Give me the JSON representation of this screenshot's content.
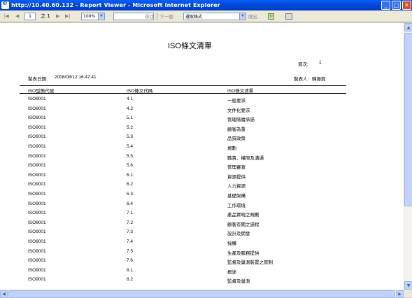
{
  "window": {
    "title": "http://10.40.60.132 - Report Viewer - Microsoft Internet Explorer",
    "minimize_glyph": "_",
    "maximize_glyph": "□",
    "close_glyph": "✕"
  },
  "toolbar": {
    "first_page": "|◀",
    "prev_page": "◀",
    "current_page": "1",
    "of_label": "之 1",
    "next_page": "▶",
    "last_page": "▶|",
    "zoom": "100%",
    "find_label": "尋找",
    "find_next_label": "下一個",
    "format_placeholder": "選取格式",
    "export_label": "匯出"
  },
  "report": {
    "title": "ISO條文清單",
    "page_label": "頁次:",
    "page_number": "1",
    "date_label": "製表日期:",
    "date_value": "2008/08/12 16:47:41",
    "creator_label": "製表人:",
    "creator_value": "陳振興",
    "columns": [
      "ISO型態代號",
      "ISO條文代碼",
      "ISO條文清單"
    ],
    "rows": [
      [
        "ISO9001",
        "4.1",
        "一般要求"
      ],
      [
        "ISO9001",
        "4.2",
        "文件化要求"
      ],
      [
        "ISO9001",
        "5.1",
        "管理階層承諾"
      ],
      [
        "ISO9001",
        "5.2",
        "顧客為重"
      ],
      [
        "ISO9001",
        "5.3",
        "品質政策"
      ],
      [
        "ISO9001",
        "5.4",
        "規劃"
      ],
      [
        "ISO9001",
        "5.5",
        "職責、權限及溝通"
      ],
      [
        "ISO9001",
        "5.6",
        "管理審查"
      ],
      [
        "ISO9001",
        "6.1",
        "資源提供"
      ],
      [
        "ISO9001",
        "6.2",
        "人力資源"
      ],
      [
        "ISO9001",
        "6.3",
        "基礎架構"
      ],
      [
        "ISO9001",
        "6.4",
        "工作環境"
      ],
      [
        "ISO9001",
        "7.1",
        "產品實現之規劃"
      ],
      [
        "ISO9001",
        "7.2",
        "顧客有關之過程"
      ],
      [
        "ISO9001",
        "7.3",
        "設計及開發"
      ],
      [
        "ISO9001",
        "7.4",
        "採購"
      ],
      [
        "ISO9001",
        "7.5",
        "生產及服務提供"
      ],
      [
        "ISO9001",
        "7.6",
        "監督及量測裝置之管制"
      ],
      [
        "ISO9001",
        "8.1",
        "概述"
      ],
      [
        "ISO9001",
        "8.2",
        "監督及量測"
      ]
    ]
  }
}
